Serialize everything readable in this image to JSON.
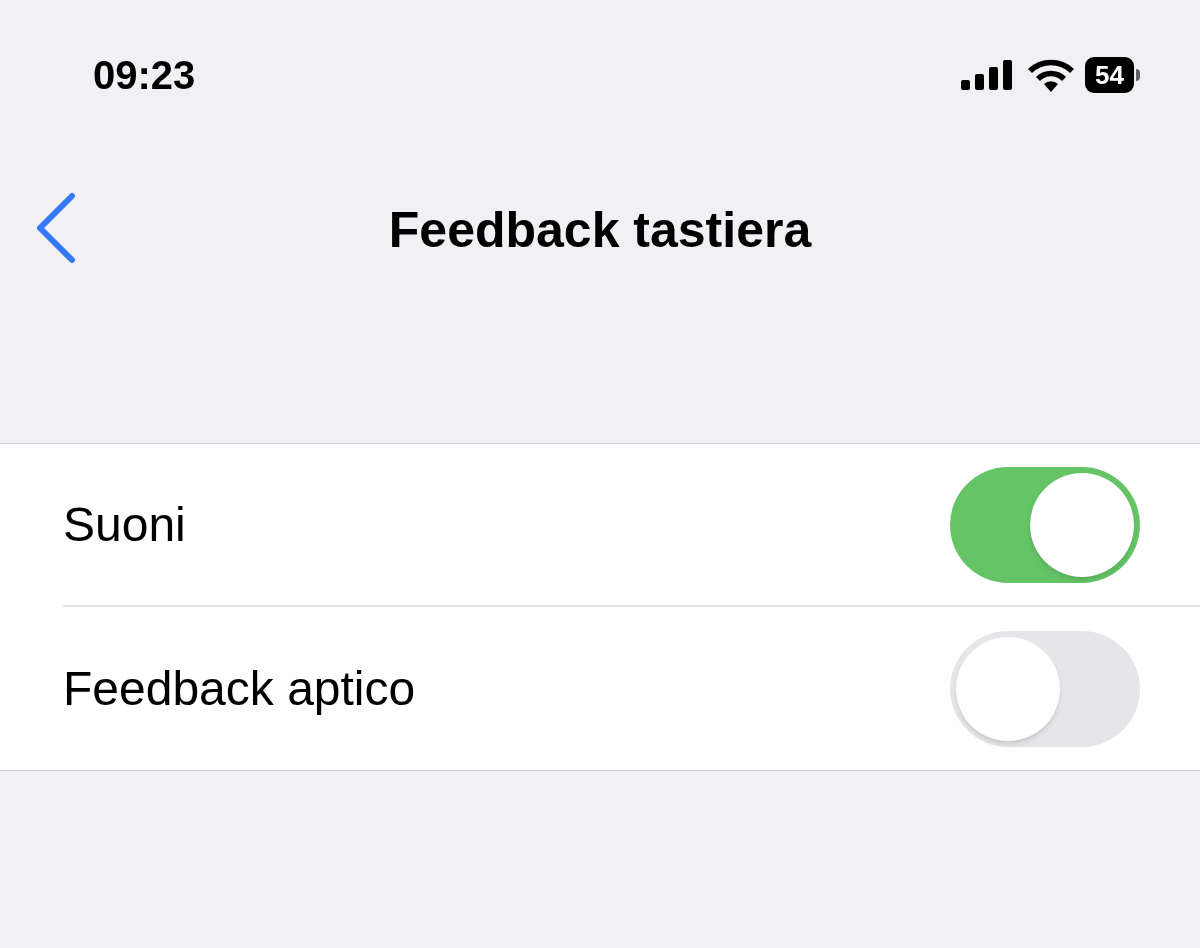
{
  "status_bar": {
    "time": "09:23",
    "battery": "54"
  },
  "nav": {
    "title": "Feedback tastiera"
  },
  "settings": [
    {
      "label": "Suoni",
      "on": true
    },
    {
      "label": "Feedback aptico",
      "on": false
    }
  ]
}
